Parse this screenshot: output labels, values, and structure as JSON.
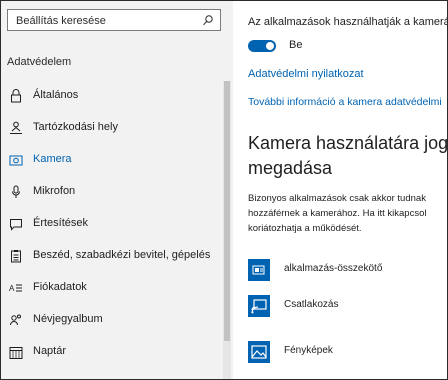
{
  "search": {
    "placeholder": "Beállítás keresése"
  },
  "sidebar": {
    "section_title": "Adatvédelem",
    "items": [
      {
        "label": "Általános",
        "icon": "lock-icon"
      },
      {
        "label": "Tartózkodási hely",
        "icon": "person-location-icon"
      },
      {
        "label": "Kamera",
        "icon": "camera-icon",
        "selected": true
      },
      {
        "label": "Mikrofon",
        "icon": "microphone-icon"
      },
      {
        "label": "Értesítések",
        "icon": "notification-icon"
      },
      {
        "label": "Beszéd, szabadkézi bevitel, gépelés",
        "icon": "clipboard-icon"
      },
      {
        "label": "Fiókadatok",
        "icon": "account-info-icon"
      },
      {
        "label": "Névjegyalbum",
        "icon": "contacts-icon"
      },
      {
        "label": "Naptár",
        "icon": "calendar-icon"
      }
    ]
  },
  "main": {
    "permission_text": "Az alkalmazások használhatják a kamerát",
    "toggle": {
      "label": "Be",
      "on": true
    },
    "privacy_link": "Adatvédelmi nyilatkozat",
    "more_info_link": "További információ a kamera adatvédelmi",
    "heading_line1": "Kamera használatára jogos",
    "heading_line2": "megadása",
    "description_lines": [
      "Bizonyos alkalmazások csak akkor tudnak",
      "hozzáférnek a kamerához. Ha itt kikapcsol",
      "koriátozhatja a működését."
    ],
    "apps": [
      {
        "name": "alkalmazás-összekötő",
        "icon": "app-connector-icon"
      },
      {
        "name": "Csatlakozás",
        "icon": "connect-icon"
      },
      {
        "name": "Fényképek",
        "icon": "photos-icon"
      }
    ]
  },
  "colors": {
    "accent": "#0063b1",
    "sidebar_bg": "#f2f2f2"
  }
}
